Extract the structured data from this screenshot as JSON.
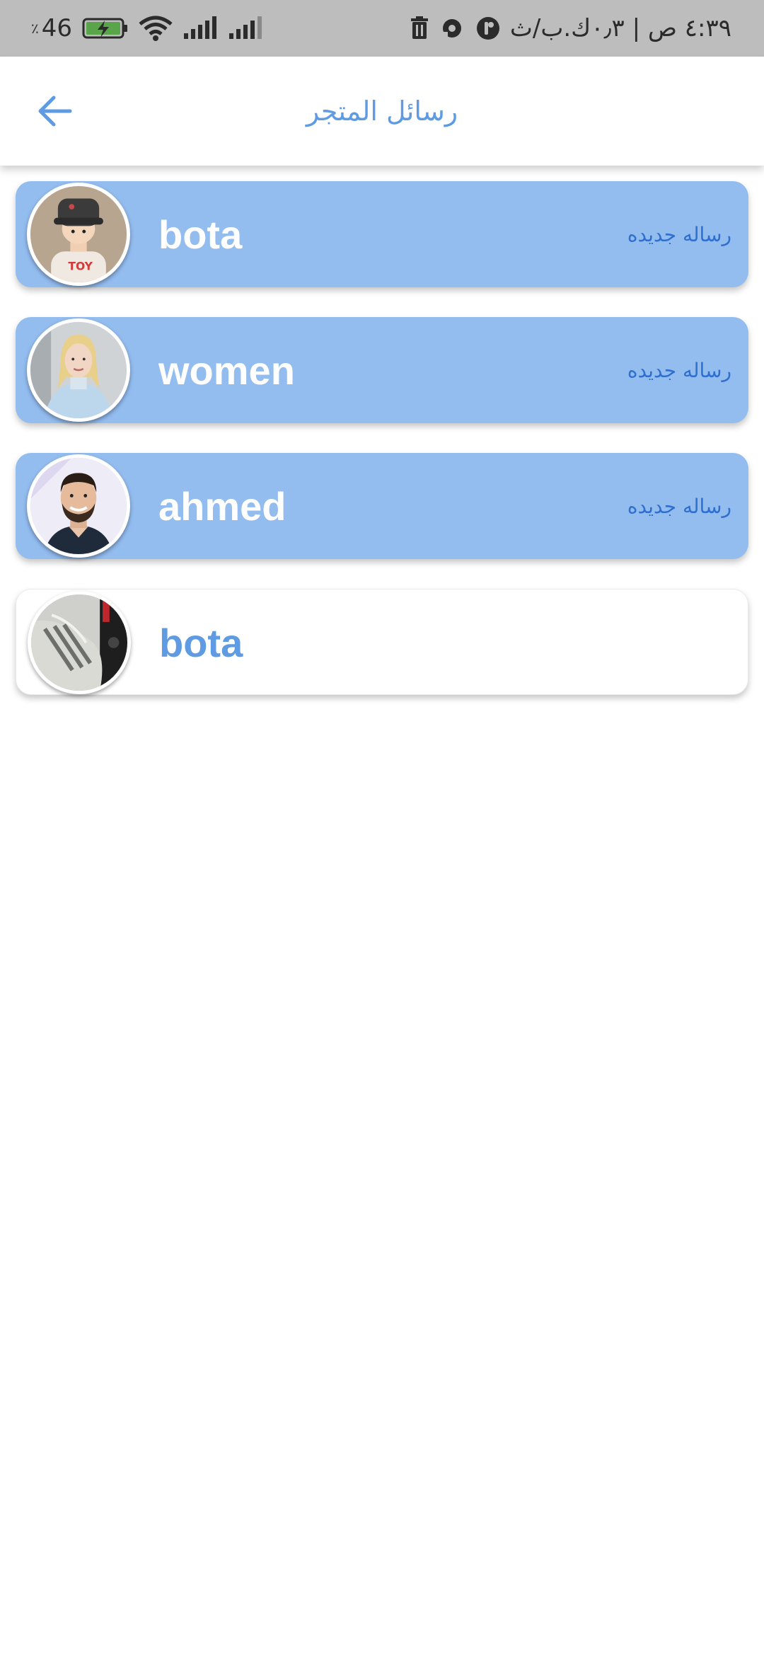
{
  "status_bar": {
    "time": "٤:٣٩ ص | ٠٫٣ك.ب/ث",
    "battery": "46",
    "percent_sign": "٪",
    "icons": [
      "trash-icon",
      "record-icon",
      "app-icon",
      "wifi-icon",
      "signal-icon",
      "battery-charging-icon"
    ]
  },
  "app_bar": {
    "title": "رسائل المتجر",
    "back_icon": "arrow-left-icon"
  },
  "colors": {
    "accent": "#5e9be2",
    "unread_card": "#93bcef",
    "badge_text": "#2f6fd0",
    "status_bar": "#bdbdbd"
  },
  "conversations": [
    {
      "name": "bota",
      "badge": "رساله جديده",
      "unread": true,
      "avatar": "child-with-hat-avatar"
    },
    {
      "name": "women",
      "badge": "رساله جديده",
      "unread": true,
      "avatar": "blonde-woman-avatar"
    },
    {
      "name": "ahmed",
      "badge": "رساله جديده",
      "unread": true,
      "avatar": "smiling-man-avatar"
    },
    {
      "name": "bota",
      "badge": "",
      "unread": false,
      "avatar": "sneaker-avatar"
    }
  ]
}
